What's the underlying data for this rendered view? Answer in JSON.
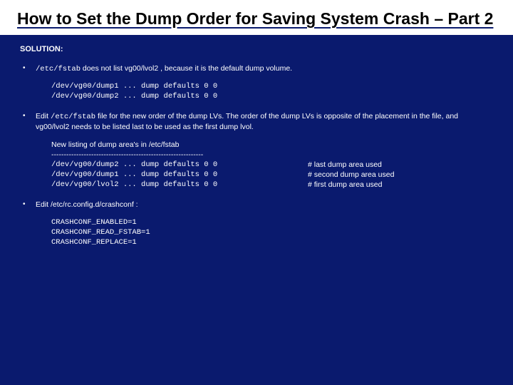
{
  "title": "How to Set the Dump Order for Saving System Crash – Part 2",
  "solution_label": "SOLUTION:",
  "bullet1": {
    "pre": "/etc/fstab",
    "post": " does not list vg00/lvol2 , because it is the default dump volume.",
    "code": "/dev/vg00/dump1 ... dump defaults 0 0\n/dev/vg00/dump2 ... dump defaults 0 0"
  },
  "bullet2": {
    "pre": "Edit ",
    "mono": "/etc/fstab",
    "post": " file for the new order of the dump LVs. The order of the dump LVs is opposite of the placement in the file, and vg00/lvol2 needs to be listed last to be used as the first dump lvol.",
    "listing_header": "New listing of dump area's in /etc/fstab",
    "separator": "-------------------------------------------------------------",
    "rows": [
      {
        "left": "/dev/vg00/dump2 ... dump defaults 0 0",
        "right": "# last dump area used"
      },
      {
        "left": "/dev/vg00/dump1 ... dump defaults 0 0",
        "right": "# second dump area used"
      },
      {
        "left": "/dev/vg00/lvol2 ... dump defaults 0 0",
        "right": "# first dump area used"
      }
    ]
  },
  "bullet3": {
    "text": "Edit /etc/rc.config.d/crashconf :",
    "code": "CRASHCONF_ENABLED=1\nCRASHCONF_READ_FSTAB=1\nCRASHCONF_REPLACE=1"
  }
}
